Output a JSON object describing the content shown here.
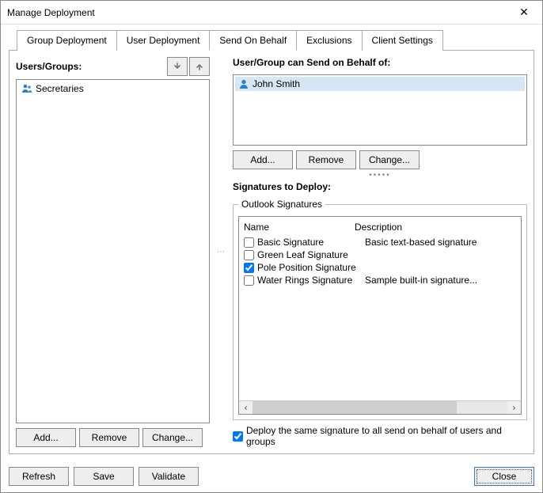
{
  "window": {
    "title": "Manage Deployment"
  },
  "tabs": {
    "group": "Group Deployment",
    "user": "User Deployment",
    "sendOnBehalf": "Send On Behalf",
    "exclusions": "Exclusions",
    "clientSettings": "Client Settings"
  },
  "left": {
    "label": "Users/Groups:",
    "items": [
      {
        "label": "Secretaries"
      }
    ],
    "buttons": {
      "add": "Add...",
      "remove": "Remove",
      "change": "Change..."
    }
  },
  "behalf": {
    "label": "User/Group can Send on Behalf of:",
    "items": [
      {
        "label": "John Smith"
      }
    ],
    "buttons": {
      "add": "Add...",
      "remove": "Remove",
      "change": "Change..."
    }
  },
  "signatures": {
    "label": "Signatures to Deploy:",
    "groupTitle": "Outlook Signatures",
    "columns": {
      "name": "Name",
      "description": "Description"
    },
    "rows": [
      {
        "checked": false,
        "name": "Basic Signature",
        "description": "Basic text-based signature"
      },
      {
        "checked": false,
        "name": "Green Leaf Signature",
        "description": ""
      },
      {
        "checked": true,
        "name": "Pole Position Signature",
        "description": ""
      },
      {
        "checked": false,
        "name": "Water Rings Signature",
        "description": "Sample built-in signature..."
      }
    ]
  },
  "deploySame": {
    "checked": true,
    "label": "Deploy the same signature to all send on behalf of users and groups"
  },
  "footer": {
    "refresh": "Refresh",
    "save": "Save",
    "validate": "Validate",
    "close": "Close"
  }
}
